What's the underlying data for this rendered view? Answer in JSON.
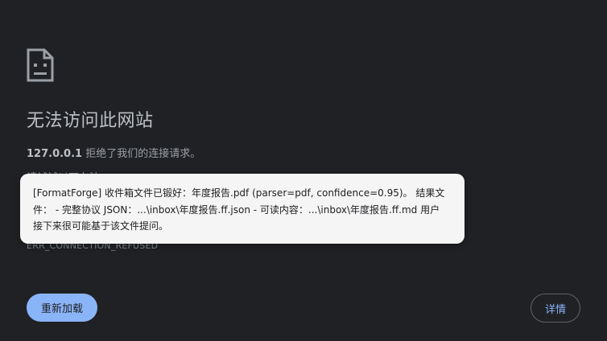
{
  "error_page": {
    "icon": "sad-page-icon",
    "title": "无法访问此网站",
    "host": "127.0.0.1",
    "host_message": " 拒绝了我们的连接请求。",
    "suggestion_partial": "请试试以下办法：",
    "error_code": "ERR_CONNECTION_REFUSED",
    "reload_button": "重新加载",
    "details_button": "详情"
  },
  "toast": {
    "message": "[FormatForge] 收件箱文件已锻好：年度报告.pdf (parser=pdf, confidence=0.95)。 结果文件： - 完整协议 JSON：...\\inbox\\年度报告.ff.json - 可读内容：...\\inbox\\年度报告.ff.md 用户接下来很可能基于该文件提问。"
  },
  "colors": {
    "background": "#202124",
    "accent": "#8ab4f8",
    "toast_background": "#f5f5f5"
  }
}
